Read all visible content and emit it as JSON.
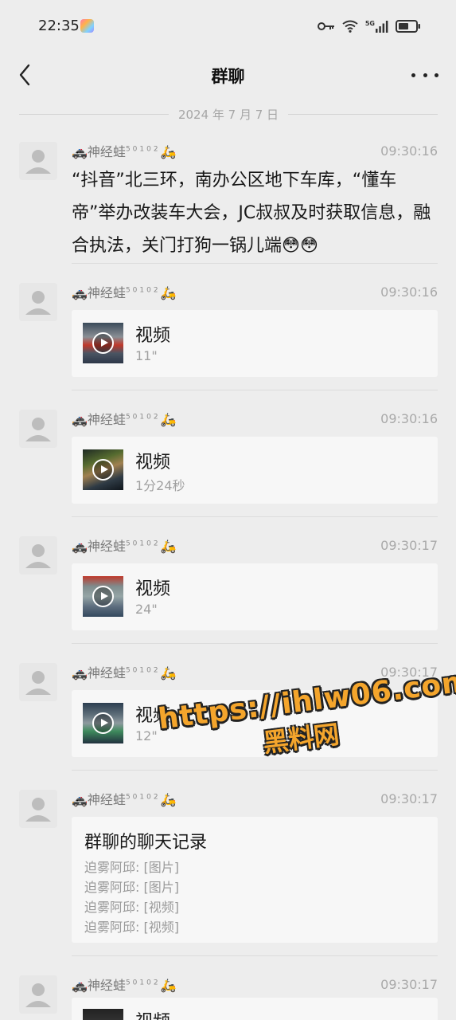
{
  "status_bar": {
    "time": "22:35",
    "network": "5G"
  },
  "nav": {
    "title": "群聊"
  },
  "date_divider": "2024 年 7 月 7 日",
  "sender": {
    "name": "神经蛙",
    "superscript": "50102"
  },
  "messages": [
    {
      "type": "text",
      "time": "09:30:16",
      "text": "“抖音”北三环，南办公区地下车库，“懂车帝”举办改装车大会，JC叔叔及时获取信息，融合执法，关门打狗一锅儿端"
    },
    {
      "type": "video",
      "time": "09:30:16",
      "title": "视频",
      "duration": "11\""
    },
    {
      "type": "video",
      "time": "09:30:16",
      "title": "视频",
      "duration": "1分24秒"
    },
    {
      "type": "video",
      "time": "09:30:17",
      "title": "视频",
      "duration": "24\""
    },
    {
      "type": "video",
      "time": "09:30:17",
      "title": "视频",
      "duration": "12\""
    },
    {
      "type": "record",
      "time": "09:30:17",
      "title": "群聊的聊天记录",
      "lines": [
        "迫雾阿邱: [图片]",
        "迫雾阿邱: [图片]",
        "迫雾阿邱: [视频]",
        "迫雾阿邱: [视频]"
      ]
    },
    {
      "type": "video",
      "time": "09:30:17",
      "title": "视频",
      "duration": ""
    }
  ],
  "watermark": {
    "url": "https://ihlw06.com",
    "text": "黑料网"
  },
  "colors": {
    "background": "#ededed",
    "card": "#f7f7f7",
    "watermark": "#f4a52c"
  }
}
